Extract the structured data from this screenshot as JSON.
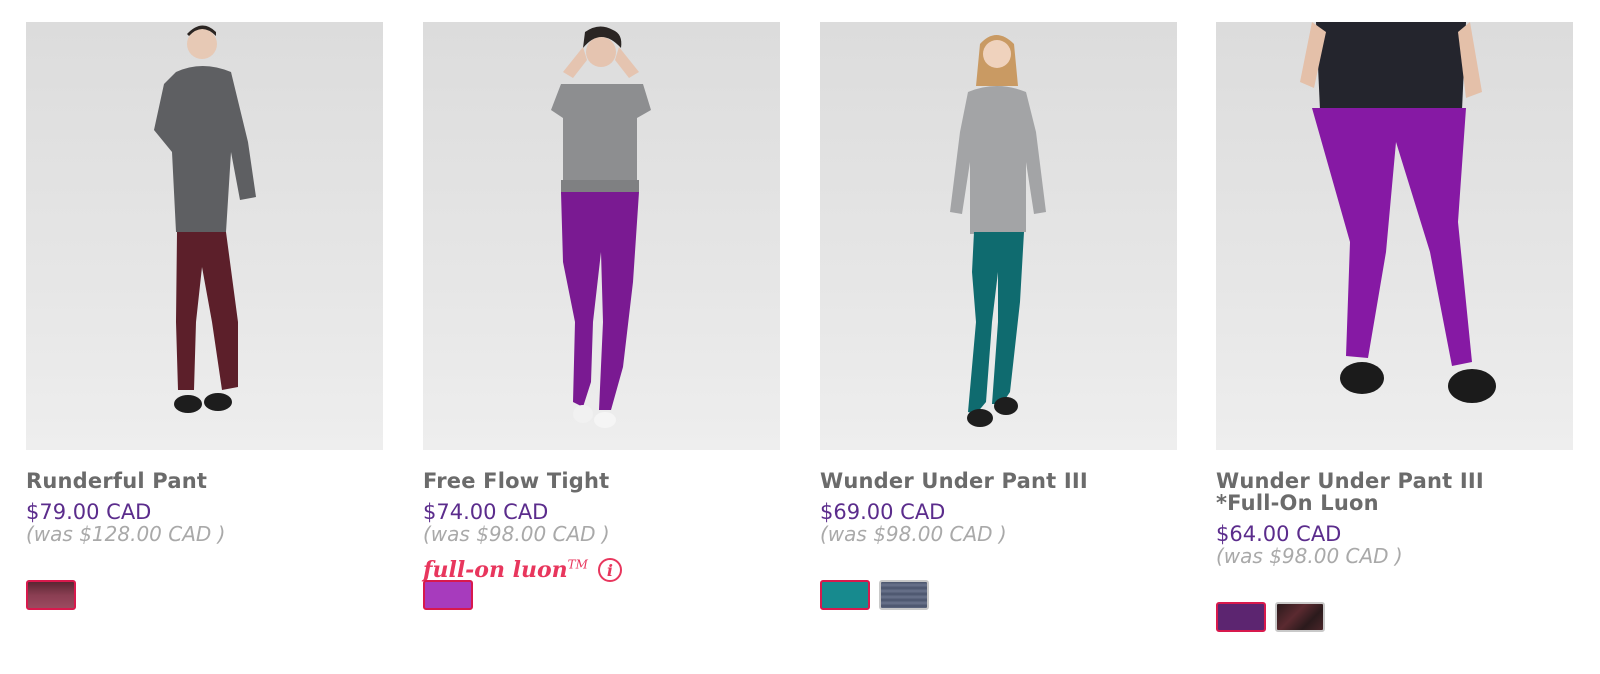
{
  "products": [
    {
      "name": "Runderful Pant",
      "price": "$79.00 CAD",
      "was": "(was $128.00 CAD )",
      "swatches": [
        {
          "color": "#7a3447",
          "selected": true
        }
      ]
    },
    {
      "name": "Free Flow Tight",
      "price": "$74.00 CAD",
      "was": "(was $98.00 CAD )",
      "badge": {
        "text": "full-on luon",
        "tm": "TM",
        "icon": "info-icon"
      },
      "swatches": [
        {
          "color": "#a73bbd",
          "selected": true
        }
      ]
    },
    {
      "name": "Wunder Under Pant III",
      "price": "$69.00 CAD",
      "was": "(was $98.00 CAD )",
      "swatches": [
        {
          "color": "#178a8e",
          "selected": true
        },
        {
          "color": "#56607a",
          "selected": false
        }
      ]
    },
    {
      "name_line1": "Wunder Under Pant III",
      "name_line2": "*Full-On Luon",
      "price": "$64.00 CAD",
      "was": "(was $98.00 CAD )",
      "swatches": [
        {
          "color": "#5c2570",
          "selected": true
        },
        {
          "color": "#3a2326",
          "selected": false
        }
      ]
    }
  ]
}
